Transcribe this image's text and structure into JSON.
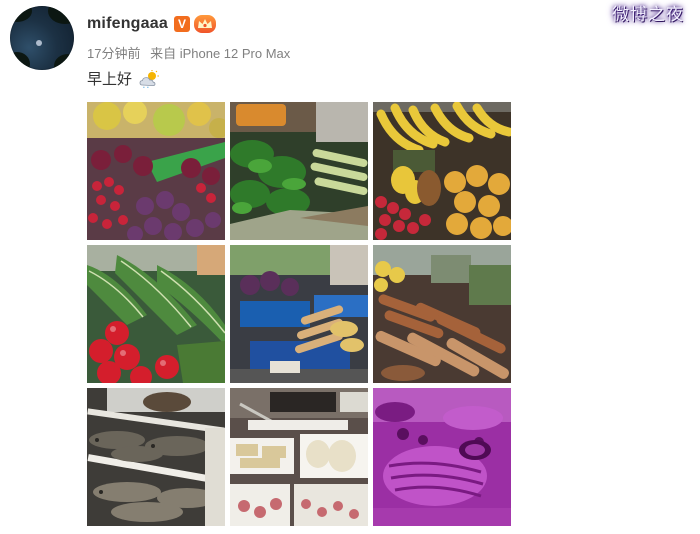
{
  "post": {
    "username": "mifengaaa",
    "verified_badge": "V",
    "vip_badge_icon": "vip-icon",
    "time_ago": "17分钟前",
    "source": "来自 iPhone 12 Pro Max",
    "text": "早上好",
    "text_emoji_icon": "sun-behind-cloud-icon"
  },
  "watermark": "微博之夜",
  "photos": [
    {
      "subject": "fruit-stall-icon"
    },
    {
      "subject": "green-vegetables-icon"
    },
    {
      "subject": "bananas-and-fruit-icon"
    },
    {
      "subject": "leafy-greens-and-tomatoes-icon"
    },
    {
      "subject": "root-vegetables-stall-icon"
    },
    {
      "subject": "yams-and-roots-icon"
    },
    {
      "subject": "fish-trays-icon"
    },
    {
      "subject": "tofu-and-food-trays-icon"
    },
    {
      "subject": "meat-under-purple-light-icon"
    }
  ],
  "colors": {
    "verified_badge": "#f26d1e",
    "meta_text": "#808080",
    "username_text": "#333333"
  }
}
